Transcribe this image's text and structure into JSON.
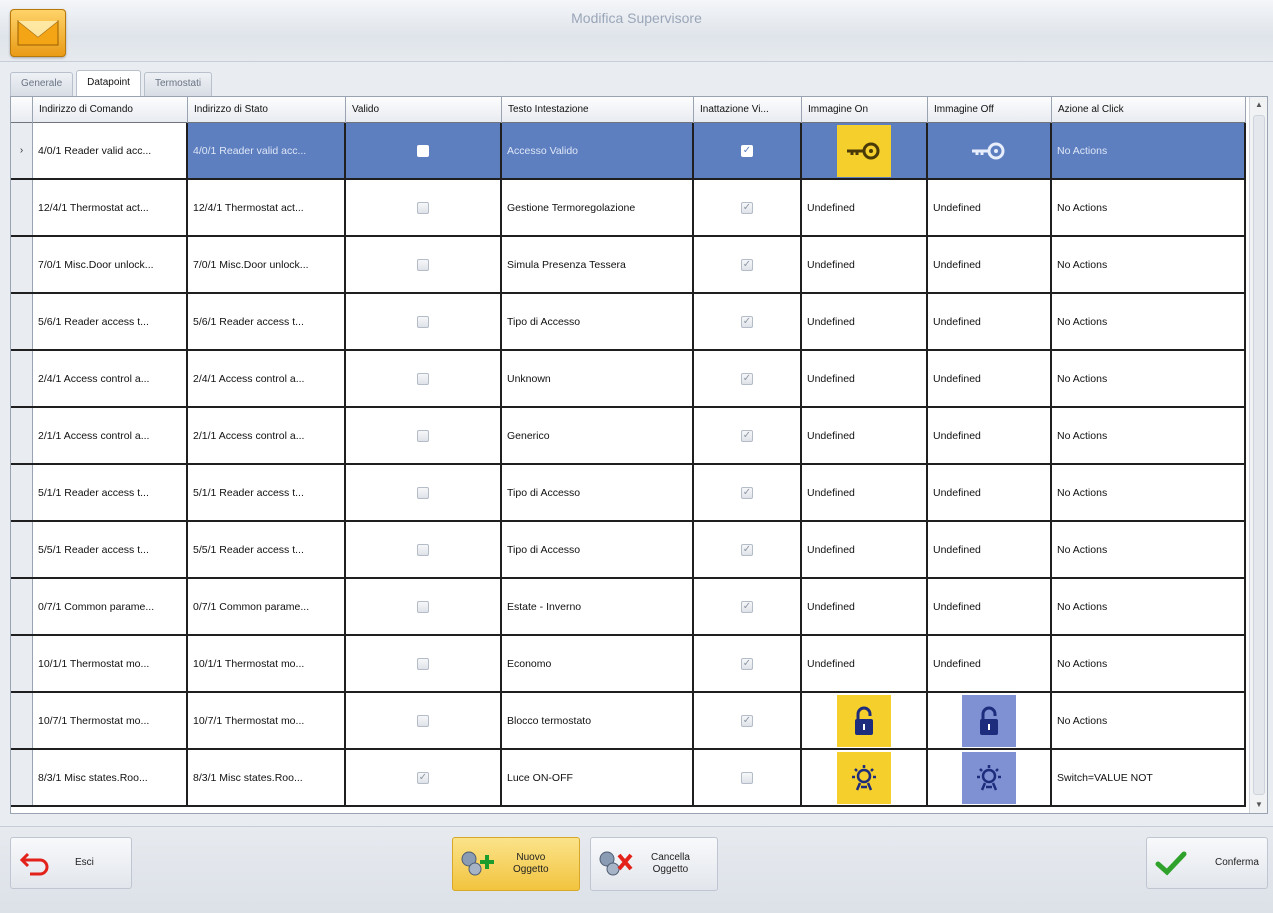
{
  "window": {
    "title": "Modifica Supervisore"
  },
  "tabs": [
    {
      "label": "Generale"
    },
    {
      "label": "Datapoint"
    },
    {
      "label": "Termostati"
    }
  ],
  "columns": [
    "Indirizzo di Comando",
    "Indirizzo di Stato",
    "Valido",
    "Testo Intestazione",
    "Inattazione Vi...",
    "Immagine On",
    "Immagine Off",
    "Azione al Click"
  ],
  "selected_row_marker": "›",
  "rows": [
    {
      "cmd": "4/0/1 Reader valid acc...",
      "state": "4/0/1 Reader valid acc...",
      "valid": false,
      "text": "Accesso Valido",
      "flag": true,
      "img_on": "key-icon",
      "img_off": "key-icon",
      "img_on_text": "",
      "img_off_text": "",
      "action": "No Actions"
    },
    {
      "cmd": "12/4/1 Thermostat act...",
      "state": "12/4/1 Thermostat act...",
      "valid": false,
      "text": "Gestione Termoregolazione",
      "flag": true,
      "img_on": null,
      "img_off": null,
      "img_on_text": "Undefined",
      "img_off_text": "Undefined",
      "action": "No Actions"
    },
    {
      "cmd": "7/0/1 Misc.Door unlock...",
      "state": "7/0/1 Misc.Door unlock...",
      "valid": false,
      "text": "Simula Presenza Tessera",
      "flag": true,
      "img_on": null,
      "img_off": null,
      "img_on_text": "Undefined",
      "img_off_text": "Undefined",
      "action": "No Actions"
    },
    {
      "cmd": "5/6/1 Reader access t...",
      "state": "5/6/1 Reader access t...",
      "valid": false,
      "text": "Tipo di Accesso",
      "flag": true,
      "img_on": null,
      "img_off": null,
      "img_on_text": "Undefined",
      "img_off_text": "Undefined",
      "action": "No Actions"
    },
    {
      "cmd": "2/4/1 Access control a...",
      "state": "2/4/1 Access control a...",
      "valid": false,
      "text": "Unknown",
      "flag": true,
      "img_on": null,
      "img_off": null,
      "img_on_text": "Undefined",
      "img_off_text": "Undefined",
      "action": "No Actions"
    },
    {
      "cmd": "2/1/1 Access control a...",
      "state": "2/1/1 Access control a...",
      "valid": false,
      "text": "Generico",
      "flag": true,
      "img_on": null,
      "img_off": null,
      "img_on_text": "Undefined",
      "img_off_text": "Undefined",
      "action": "No Actions"
    },
    {
      "cmd": "5/1/1 Reader access t...",
      "state": "5/1/1 Reader access t...",
      "valid": false,
      "text": "Tipo di Accesso",
      "flag": true,
      "img_on": null,
      "img_off": null,
      "img_on_text": "Undefined",
      "img_off_text": "Undefined",
      "action": "No Actions"
    },
    {
      "cmd": "5/5/1 Reader access t...",
      "state": "5/5/1 Reader access t...",
      "valid": false,
      "text": "Tipo di Accesso",
      "flag": true,
      "img_on": null,
      "img_off": null,
      "img_on_text": "Undefined",
      "img_off_text": "Undefined",
      "action": "No Actions"
    },
    {
      "cmd": "0/7/1 Common parame...",
      "state": "0/7/1 Common parame...",
      "valid": false,
      "text": "Estate - Inverno",
      "flag": true,
      "img_on": null,
      "img_off": null,
      "img_on_text": "Undefined",
      "img_off_text": "Undefined",
      "action": "No Actions"
    },
    {
      "cmd": "10/1/1 Thermostat mo...",
      "state": "10/1/1 Thermostat mo...",
      "valid": false,
      "text": "Economo",
      "flag": true,
      "img_on": null,
      "img_off": null,
      "img_on_text": "Undefined",
      "img_off_text": "Undefined",
      "action": "No Actions"
    },
    {
      "cmd": "10/7/1 Thermostat mo...",
      "state": "10/7/1 Thermostat mo...",
      "valid": false,
      "text": "Blocco termostato",
      "flag": true,
      "img_on": "padlock-icon",
      "img_off": "padlock-icon",
      "img_on_text": "",
      "img_off_text": "",
      "action": "No Actions"
    },
    {
      "cmd": "8/3/1 Misc states.Roo...",
      "state": "8/3/1 Misc states.Roo...",
      "valid": true,
      "text": "Luce ON-OFF",
      "flag": false,
      "img_on": "light-bulb-icon",
      "img_off": "light-bulb-icon",
      "img_on_text": "",
      "img_off_text": "",
      "action": "Switch=VALUE NOT"
    }
  ],
  "footer": {
    "exit_label": "Esci",
    "new_label_1": "Nuovo",
    "new_label_2": "Oggetto",
    "delete_label_1": "Cancella",
    "delete_label_2": "Oggetto",
    "confirm_label": "Conferma"
  },
  "colors": {
    "selection": "#5d7fc0",
    "image_on_bg": "#f5cf2b",
    "image_off_bg": "#7f91d2"
  }
}
